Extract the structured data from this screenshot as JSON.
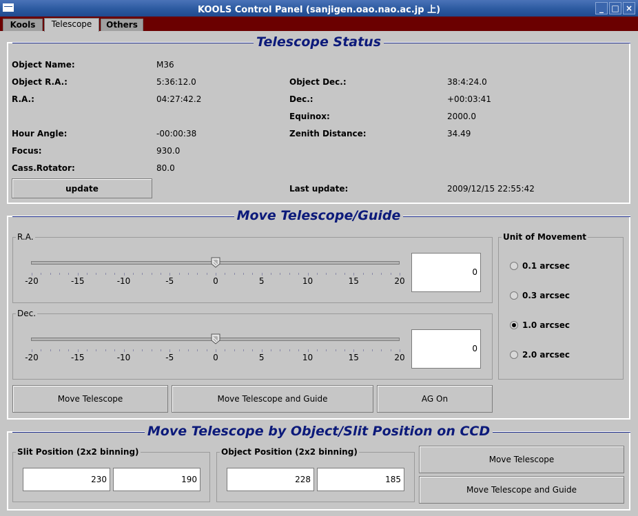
{
  "window": {
    "title": "KOOLS Control Panel (sanjigen.oao.nao.ac.jp 上)"
  },
  "tabs": [
    {
      "label": "Kools",
      "active": false
    },
    {
      "label": "Telescope",
      "active": true
    },
    {
      "label": "Others",
      "active": false
    }
  ],
  "status": {
    "title": "Telescope Status",
    "object_name_label": "Object Name:",
    "object_name": "M36",
    "object_ra_label": "Object R.A.:",
    "object_ra": "5:36:12.0",
    "object_dec_label": "Object Dec.:",
    "object_dec": "38:4:24.0",
    "ra_label": "R.A.:",
    "ra": "04:27:42.2",
    "dec_label": "Dec.:",
    "dec": "+00:03:41",
    "equinox_label": "Equinox:",
    "equinox": "2000.0",
    "hour_angle_label": "Hour Angle:",
    "hour_angle": "-00:00:38",
    "zenith_label": "Zenith Distance:",
    "zenith": "34.49",
    "focus_label": "Focus:",
    "focus": "930.0",
    "cass_label": "Cass.Rotator:",
    "cass": "80.0",
    "update_button": "update",
    "last_update_label": "Last update:",
    "last_update": "2009/12/15 22:55:42"
  },
  "move": {
    "title": "Move Telescope/Guide",
    "ra_group": "R.A.",
    "dec_group": "Dec.",
    "tick_labels": [
      "-20",
      "-15",
      "-10",
      "-5",
      "0",
      "5",
      "10",
      "15",
      "20"
    ],
    "ra_value": "0",
    "dec_value": "0",
    "ra_slider": 0,
    "dec_slider": 0,
    "unit_title": "Unit of Movement",
    "units": [
      {
        "label": "0.1 arcsec",
        "selected": false
      },
      {
        "label": "0.3 arcsec",
        "selected": false
      },
      {
        "label": "1.0 arcsec",
        "selected": true
      },
      {
        "label": "2.0 arcsec",
        "selected": false
      }
    ],
    "move_telescope_button": "Move Telescope",
    "move_guide_button": "Move Telescope and Guide",
    "ag_button": "AG On"
  },
  "ccd": {
    "title": "Move Telescope by Object/Slit Position on CCD",
    "slit_title": "Slit Position (2x2 binning)",
    "slit_x": "230",
    "slit_y": "190",
    "object_title": "Object Position (2x2 binning)",
    "object_x": "228",
    "object_y": "185",
    "move_telescope_button": "Move Telescope",
    "move_guide_button": "Move Telescope and Guide"
  }
}
